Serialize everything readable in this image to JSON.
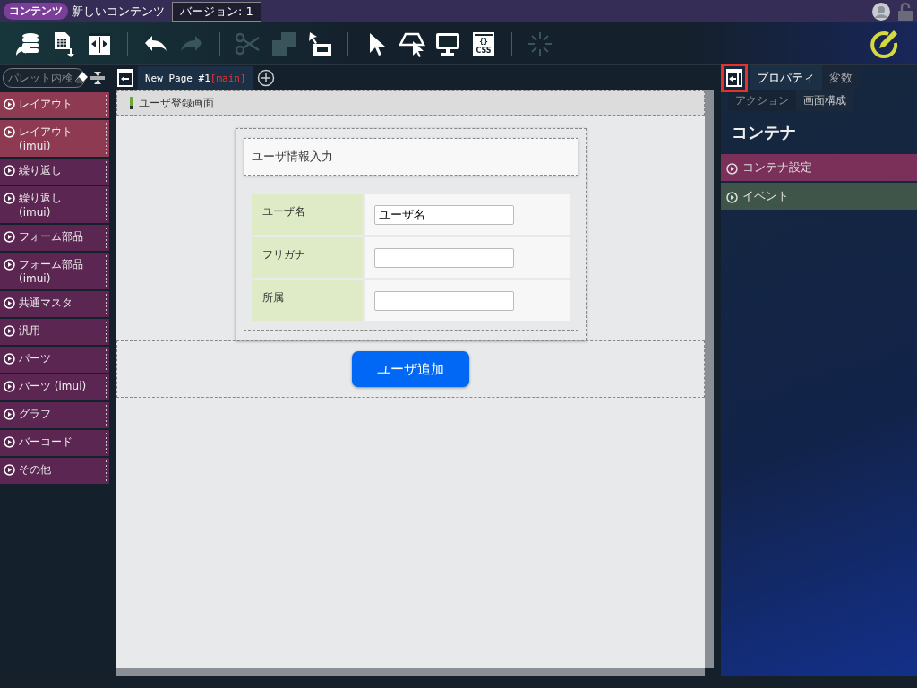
{
  "header": {
    "badge": "コンテンツ",
    "title": "新しいコンテンツ",
    "version": "バージョン: 1"
  },
  "toolbar": [
    {
      "kind": "database",
      "disabled": false
    },
    {
      "kind": "sheet",
      "disabled": false
    },
    {
      "kind": "resize",
      "disabled": false
    },
    {
      "kind": "sep"
    },
    {
      "kind": "undo",
      "disabled": false
    },
    {
      "kind": "redo",
      "disabled": true
    },
    {
      "kind": "sep"
    },
    {
      "kind": "cut",
      "disabled": true
    },
    {
      "kind": "copy",
      "disabled": true
    },
    {
      "kind": "paste",
      "disabled": false
    },
    {
      "kind": "sep"
    },
    {
      "kind": "pointer",
      "disabled": false
    },
    {
      "kind": "select",
      "disabled": false
    },
    {
      "kind": "monitor",
      "disabled": false
    },
    {
      "kind": "css",
      "disabled": false
    },
    {
      "kind": "sep"
    },
    {
      "kind": "spinner",
      "disabled": true
    }
  ],
  "css_label": "{}",
  "css_text": "CSS",
  "palette": {
    "placeholder": "パレット内検",
    "items": [
      {
        "label": "レイアウト",
        "color": "#8e3a52"
      },
      {
        "label": "レイアウト (imui)",
        "color": "#8e3a52"
      },
      {
        "label": "繰り返し",
        "color": "#5c2652"
      },
      {
        "label": "繰り返し (imui)",
        "color": "#5c2652"
      },
      {
        "label": "フォーム部品",
        "color": "#5c2652"
      },
      {
        "label": "フォーム部品 (imui)",
        "color": "#5c2652"
      },
      {
        "label": "共通マスタ",
        "color": "#5c2652"
      },
      {
        "label": "汎用",
        "color": "#5c2652"
      },
      {
        "label": "パーツ",
        "color": "#5c2652"
      },
      {
        "label": "パーツ (imui)",
        "color": "#5c2652"
      },
      {
        "label": "グラフ",
        "color": "#5c2652"
      },
      {
        "label": "バーコード",
        "color": "#5c2652"
      },
      {
        "label": "その他",
        "color": "#5c2652"
      }
    ]
  },
  "page_tab": {
    "name": "New Page #1",
    "tag": "[main]"
  },
  "canvas": {
    "page_title": "ユーザ登録画面",
    "form_title": "ユーザ情報入力",
    "rows": [
      {
        "label": "ユーザ名",
        "value": "ユーザ名"
      },
      {
        "label": "フリガナ",
        "value": ""
      },
      {
        "label": "所属",
        "value": ""
      }
    ],
    "button": "ユーザ追加"
  },
  "properties": {
    "tabs": [
      {
        "label": "プロパティ",
        "selected": true
      },
      {
        "label": "変数",
        "selected": false
      }
    ],
    "subtabs": [
      {
        "label": "アクション",
        "selected": false
      },
      {
        "label": "画面構成",
        "selected": true
      }
    ],
    "heading": "コンテナ",
    "sections": [
      {
        "label": "コンテナ設定",
        "color": "#7a3058"
      },
      {
        "label": "イベント",
        "color": "#3f5549"
      }
    ]
  }
}
